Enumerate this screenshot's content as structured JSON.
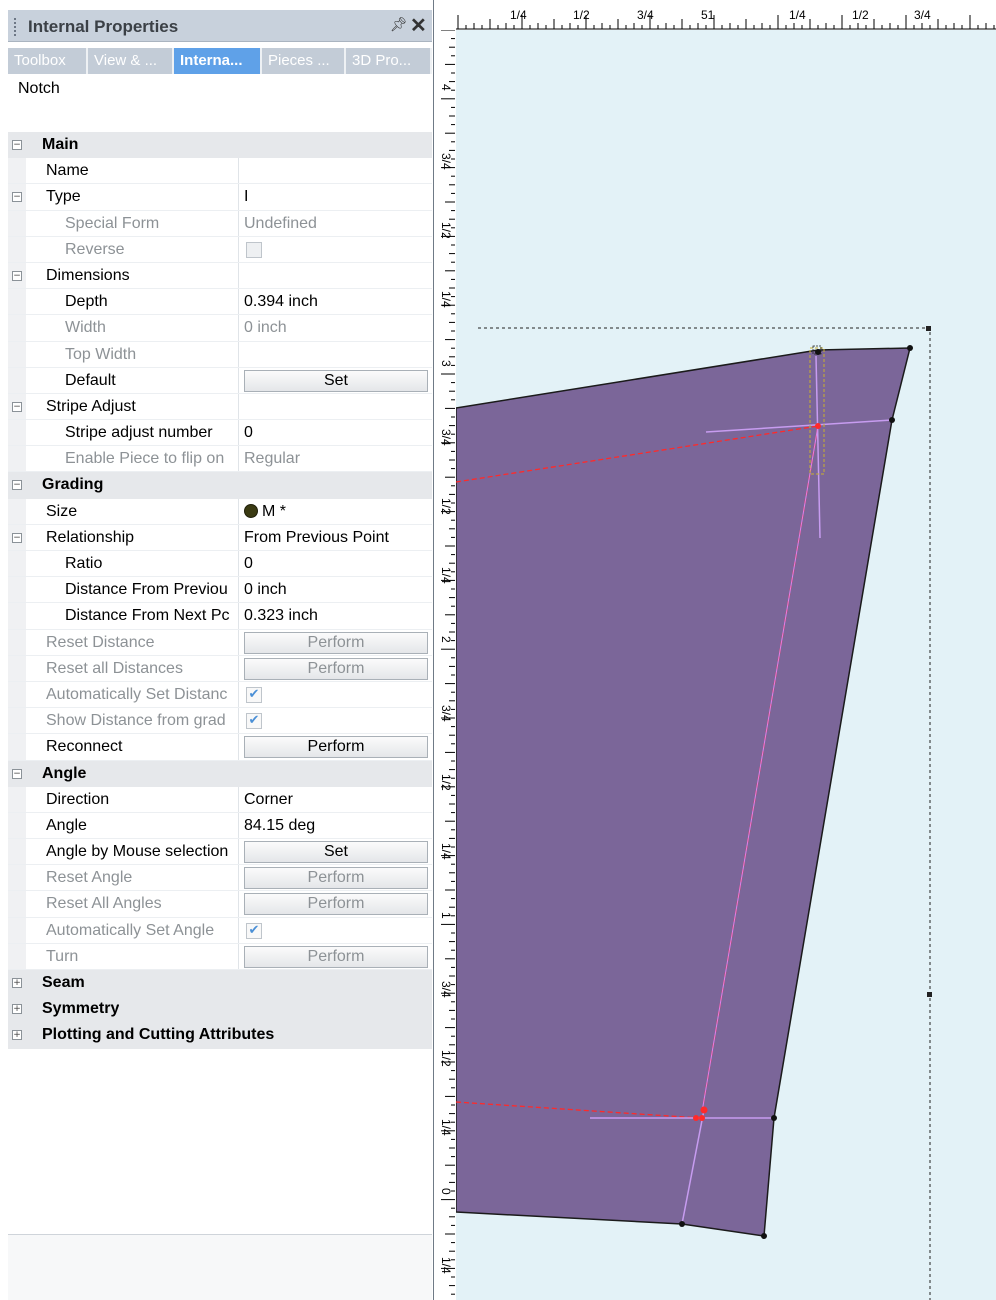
{
  "panel": {
    "title": "Internal Properties",
    "pin_glyph": "ᵖ",
    "close_glyph": "✕",
    "tabs": [
      {
        "label": "Toolbox",
        "active": false
      },
      {
        "label": "View & ...",
        "active": false
      },
      {
        "label": "Interna...",
        "active": true
      },
      {
        "label": "Pieces ...",
        "active": false
      },
      {
        "label": "3D Pro...",
        "active": false
      }
    ],
    "object_type": "Notch"
  },
  "grid": {
    "main": "Main",
    "name": "Name",
    "name_value": "",
    "type": "Type",
    "type_value": "I",
    "special_form": "Special Form",
    "special_form_value": "Undefined",
    "reverse": "Reverse",
    "dimensions": "Dimensions",
    "depth": "Depth",
    "depth_value": "0.394 inch",
    "width": "Width",
    "width_value": "0 inch",
    "top_width": "Top Width",
    "top_width_value": "",
    "default": "Default",
    "set_label": "Set",
    "stripe_adjust": "Stripe Adjust",
    "stripe_adjust_number": "Stripe adjust number",
    "stripe_adjust_number_value": "0",
    "enable_flip": "Enable Piece to flip on",
    "enable_flip_value": "Regular",
    "grading": "Grading",
    "size": "Size",
    "size_value": "M *",
    "relationship": "Relationship",
    "relationship_value": "From Previous Point",
    "ratio": "Ratio",
    "ratio_value": "0",
    "dist_prev": "Distance From Previou",
    "dist_prev_value": "0 inch",
    "dist_next": "Distance From Next Pc",
    "dist_next_value": "0.323 inch",
    "reset_distance": "Reset Distance",
    "reset_all_distances": "Reset all Distances",
    "perform_label": "Perform",
    "auto_set_distance": "Automatically Set Distanc",
    "show_distance": "Show Distance from grad",
    "reconnect": "Reconnect",
    "angle_cat": "Angle",
    "direction": "Direction",
    "direction_value": "Corner",
    "angle": "Angle",
    "angle_value": "84.15 deg",
    "angle_by_mouse": "Angle by Mouse selection",
    "reset_angle": "Reset Angle",
    "reset_all_angles": "Reset All Angles",
    "auto_set_angle": "Automatically Set Angle",
    "turn": "Turn",
    "seam": "Seam",
    "symmetry": "Symmetry",
    "plotting": "Plotting and Cutting Attributes",
    "check_glyph": "✔",
    "minus_glyph": "−",
    "plus_glyph": "+"
  },
  "ruler": {
    "top_labels": [
      "1/4",
      "1/2",
      "3/4",
      "51",
      "1/4",
      "1/2",
      "3/4"
    ],
    "left_labels": [
      "4",
      "3/4",
      "1/2",
      "1/4",
      "3",
      "3/4",
      "1/2",
      "1/4",
      "2",
      "3/4",
      "1/2",
      "1/4",
      "1",
      "3/4",
      "1/2",
      "1/4",
      "0",
      "1/4"
    ]
  },
  "colors": {
    "piece_fill": "#7b6699",
    "internal_line": "#ff2a2a",
    "notch_line": "#c79cf0",
    "canvas_bg": "#e3f2f7",
    "active_tab": "#5fa1e8"
  }
}
